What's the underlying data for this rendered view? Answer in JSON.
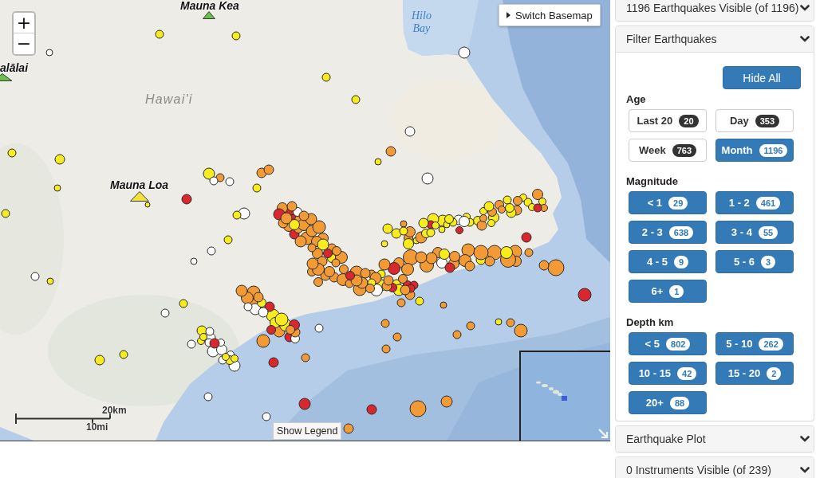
{
  "map": {
    "zoom": {
      "in": "+",
      "out": "−"
    },
    "basemap_button": "Switch Basemap",
    "volcanoes": [
      {
        "label": "Mauna Kea",
        "color": "#6cbf4a"
      },
      {
        "label": "alālai",
        "color": "#6cbf4a"
      },
      {
        "label": "Mauna Loa",
        "color": "#f3e23b"
      }
    ],
    "labels": [
      {
        "kind": "region",
        "text": "Hawai'i"
      },
      {
        "kind": "water",
        "text": "Hilo Bay"
      }
    ],
    "scale": {
      "metric": "20km",
      "imperial": "10mi"
    },
    "legend_button": "Show Legend"
  },
  "panels": [
    {
      "title": "1196 Earthquakes Visible (of 1196)",
      "expanded": false
    },
    {
      "title": "Filter Earthquakes",
      "expanded": true,
      "button": "Hide All",
      "groups": [
        {
          "label": "Age",
          "options": [
            {
              "label": "Last 20",
              "count": "20",
              "selected": false
            },
            {
              "label": "Day",
              "count": "353",
              "selected": false
            },
            {
              "label": "Week",
              "count": "763",
              "selected": false
            },
            {
              "label": "Month",
              "count": "1196",
              "selected": true
            }
          ]
        },
        {
          "label": "Magnitude",
          "options": [
            {
              "label": "< 1",
              "count": "29",
              "selected": true
            },
            {
              "label": "1 - 2",
              "count": "461",
              "selected": true
            },
            {
              "label": "2 - 3",
              "count": "638",
              "selected": true
            },
            {
              "label": "3 - 4",
              "count": "55",
              "selected": true
            },
            {
              "label": "4 - 5",
              "count": "9",
              "selected": true
            },
            {
              "label": "5 - 6",
              "count": "3",
              "selected": true
            },
            {
              "label": "6+",
              "count": "1",
              "selected": true
            }
          ]
        },
        {
          "label": "Depth km",
          "options": [
            {
              "label": "< 5",
              "count": "802",
              "selected": true
            },
            {
              "label": "5 - 10",
              "count": "262",
              "selected": true
            },
            {
              "label": "10 - 15",
              "count": "42",
              "selected": true
            },
            {
              "label": "15 - 20",
              "count": "2",
              "selected": true
            },
            {
              "label": "20+",
              "count": "88",
              "selected": true
            }
          ]
        }
      ]
    },
    {
      "title": "Earthquake Plot",
      "expanded": false
    },
    {
      "title": "0 Instruments Visible (of 239)",
      "expanded": false
    }
  ]
}
